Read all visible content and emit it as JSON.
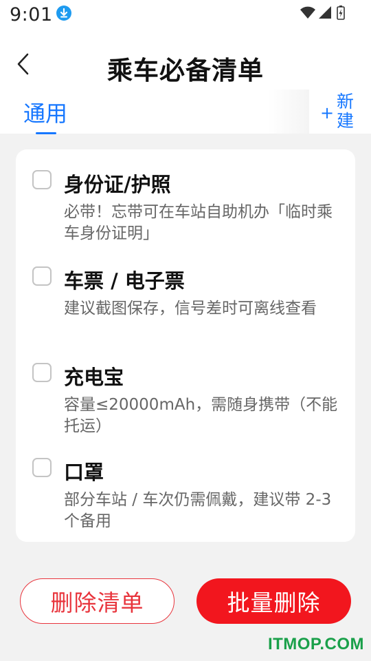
{
  "status_bar": {
    "time": "9:01",
    "icons": [
      "download-icon",
      "wifi-icon",
      "signal-icon",
      "battery-icon"
    ]
  },
  "header": {
    "title": "乘车必备清单",
    "back_icon": "chevron-left-icon"
  },
  "tabs": {
    "items": [
      {
        "label": "通用",
        "active": true
      }
    ],
    "new_button": {
      "plus": "+",
      "label": "新建"
    }
  },
  "checklist": [
    {
      "title": "身份证/护照",
      "description": "必带！忘带可在车站自助机办「临时乘车身份证明」",
      "checked": false
    },
    {
      "title": "车票 / 电子票",
      "description": "建议截图保存，信号差时可离线查看",
      "checked": false
    },
    {
      "title": "充电宝",
      "description": "容量≤20000mAh，需随身携带（不能托运）",
      "checked": false
    },
    {
      "title": "口罩",
      "description": "部分车站 / 车次仍需佩戴，建议带 2-3 个备用",
      "checked": false
    }
  ],
  "actions": {
    "delete_list": "删除清单",
    "batch_delete": "批量删除"
  },
  "watermark": "ITMOP.COM",
  "colors": {
    "accent": "#1677ff",
    "danger": "#f2161e",
    "background": "#f2f2f2",
    "watermark": "#1aa04a"
  }
}
